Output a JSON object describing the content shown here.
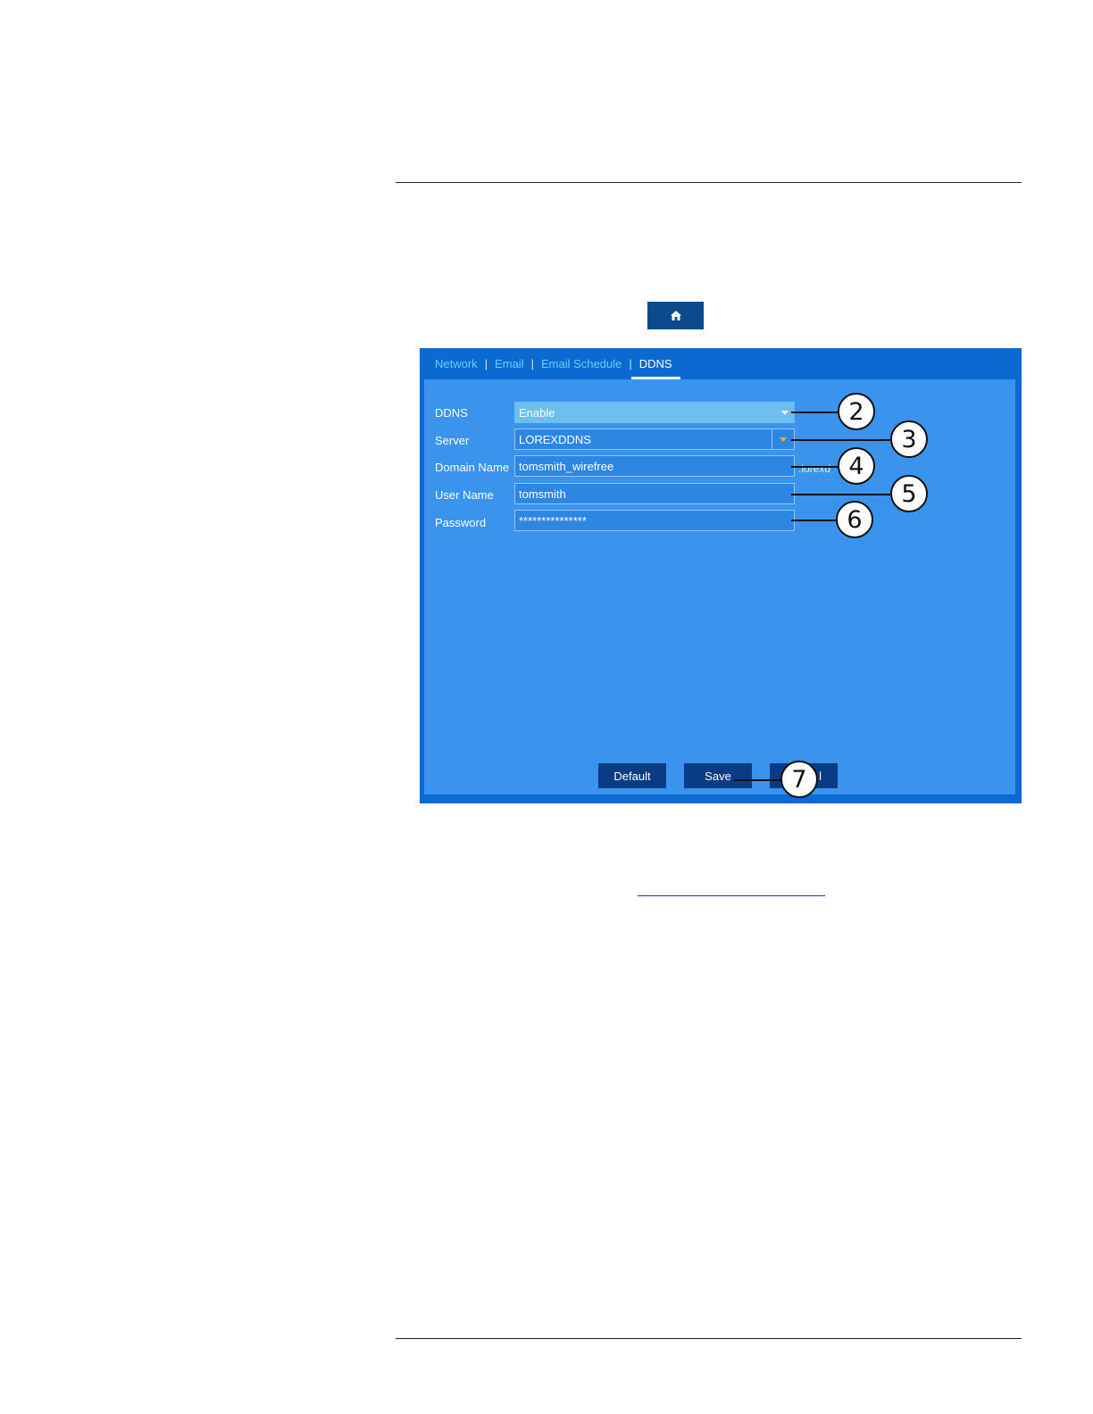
{
  "header": {
    "home_icon": "home-icon"
  },
  "tabs": [
    {
      "label": "Network"
    },
    {
      "label": "Email"
    },
    {
      "label": "Email Schedule"
    },
    {
      "label": "DDNS"
    }
  ],
  "tab_separator": "|",
  "form": {
    "ddns": {
      "label": "DDNS",
      "value": "Enable"
    },
    "server": {
      "label": "Server",
      "value": "LOREXDDNS"
    },
    "domain": {
      "label": "Domain Name",
      "value": "tomsmith_wirefree",
      "suffix": ".lorexd"
    },
    "username": {
      "label": "User Name",
      "value": "tomsmith"
    },
    "password": {
      "label": "Password",
      "value": "***************"
    }
  },
  "buttons": {
    "default": "Default",
    "save": "Save",
    "cancel_partial": "l"
  },
  "callouts": [
    "2",
    "3",
    "4",
    "5",
    "6",
    "7"
  ],
  "colors": {
    "window": "#0a6ad1",
    "panel": "#3a93ec",
    "tab_active": "#ffffff",
    "tab_inactive": "#69d0ff",
    "button": "#0a3c86"
  }
}
